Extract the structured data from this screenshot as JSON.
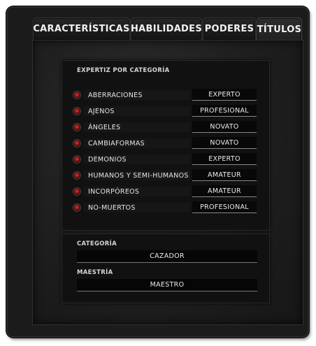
{
  "tabs": [
    {
      "label": "CARACTERÍSTICAS"
    },
    {
      "label": "HABILIDADES"
    },
    {
      "label": "PODERES"
    },
    {
      "label": "TÍTULOS"
    }
  ],
  "expertise": {
    "title": "EXPERTIZ POR CATEGORÍA",
    "rows": [
      {
        "label": "ABERRACIONES",
        "level": "EXPERTO"
      },
      {
        "label": "AJENOS",
        "level": "PROFESIONAL"
      },
      {
        "label": "ÁNGELES",
        "level": "NOVATO"
      },
      {
        "label": "CAMBIAFORMAS",
        "level": "NOVATO"
      },
      {
        "label": "DEMONIOS",
        "level": "EXPERTO"
      },
      {
        "label": "HUMANOS Y SEMI-HUMANOS",
        "level": "AMATEUR"
      },
      {
        "label": "INCORPÓREOS",
        "level": "AMATEUR"
      },
      {
        "label": "NO-MUERTOS",
        "level": "PROFESIONAL"
      }
    ]
  },
  "summary": {
    "category_label": "CATEGORÍA",
    "category_value": "CAZADOR",
    "mastery_label": "MAESTRÍA",
    "mastery_value": "MAESTRO"
  },
  "colors": {
    "indicator": "#b02020",
    "background": "#1b1b1b"
  }
}
